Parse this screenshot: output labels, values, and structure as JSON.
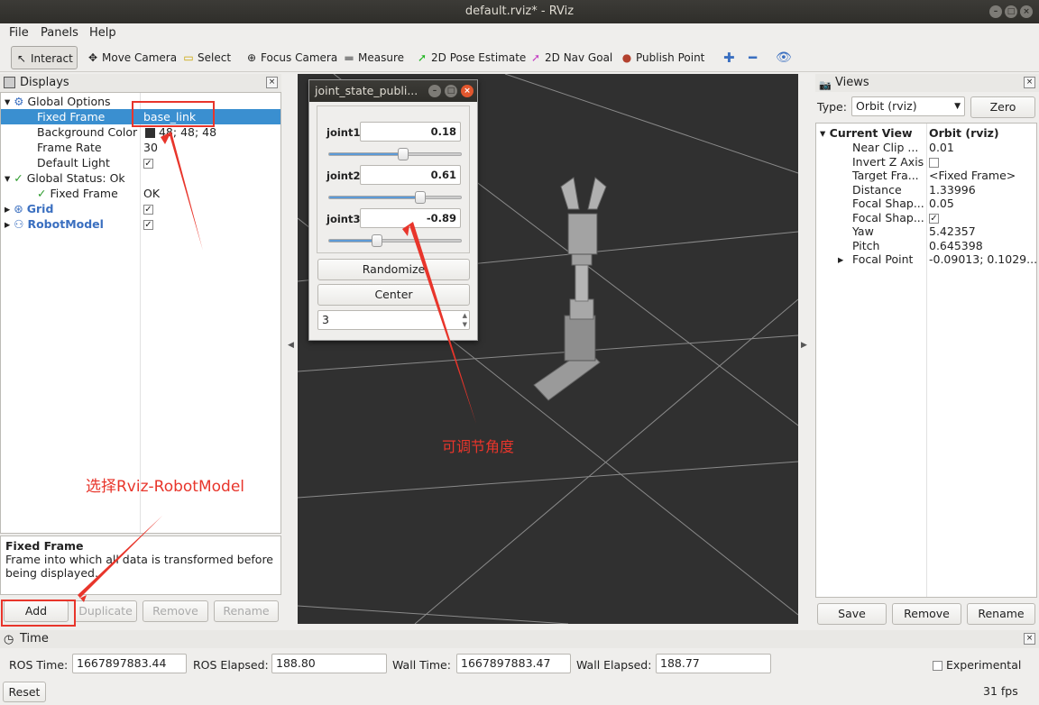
{
  "window": {
    "title": "default.rviz* - RViz"
  },
  "menu": [
    "File",
    "Panels",
    "Help"
  ],
  "toolbar": [
    {
      "label": "Interact",
      "icon": "↖",
      "name": "interact-button"
    },
    {
      "label": "Move Camera",
      "icon": "✥",
      "name": "move-camera-button"
    },
    {
      "label": "Select",
      "icon": "▭",
      "name": "select-button"
    },
    {
      "label": "Focus Camera",
      "icon": "⊕",
      "name": "focus-camera-button"
    },
    {
      "label": "Measure",
      "icon": "▬",
      "name": "measure-button"
    },
    {
      "label": "2D Pose Estimate",
      "icon": "➚",
      "name": "2d-pose-estimate-button"
    },
    {
      "label": "2D Nav Goal",
      "icon": "➚",
      "name": "2d-nav-goal-button"
    },
    {
      "label": "Publish Point",
      "icon": "●",
      "name": "publish-point-button"
    }
  ],
  "displays": {
    "title": "Displays",
    "rows": {
      "global_options": "Global Options",
      "fixed_frame_label": "Fixed Frame",
      "fixed_frame_value": "base_link",
      "bg_color_label": "Background Color",
      "bg_color_value": "48; 48; 48",
      "frame_rate_label": "Frame Rate",
      "frame_rate_value": "30",
      "default_light_label": "Default Light",
      "global_status": "Global Status: Ok",
      "gs_fixed_frame_label": "Fixed Frame",
      "gs_fixed_frame_value": "OK",
      "grid": "Grid",
      "robot_model": "RobotModel"
    },
    "desc_title": "Fixed Frame",
    "desc_text": "Frame into which all data is transformed before being displayed.",
    "buttons": {
      "add": "Add",
      "duplicate": "Duplicate",
      "remove": "Remove",
      "rename": "Rename"
    }
  },
  "joint_popup": {
    "title": "joint_state_publi...",
    "joints": [
      {
        "label": "joint1",
        "value": "0.18",
        "fraction": 0.56
      },
      {
        "label": "joint2",
        "value": "0.61",
        "fraction": 0.69
      },
      {
        "label": "joint3",
        "value": "-0.89",
        "fraction": 0.36
      }
    ],
    "randomize": "Randomize",
    "center": "Center",
    "spin_value": "3"
  },
  "views": {
    "title": "Views",
    "type_label": "Type:",
    "type_value": "Orbit (rviz)",
    "zero": "Zero",
    "current_view": "Current View",
    "current_view_value": "Orbit (rviz)",
    "props": [
      {
        "k": "Near Clip ...",
        "v": "0.01"
      },
      {
        "k": "Invert Z Axis",
        "v": ""
      },
      {
        "k": "Target Fra...",
        "v": "<Fixed Frame>"
      },
      {
        "k": "Distance",
        "v": "1.33996"
      },
      {
        "k": "Focal Shap...",
        "v": "0.05"
      },
      {
        "k": "Focal Shap...",
        "v": ""
      },
      {
        "k": "Yaw",
        "v": "5.42357"
      },
      {
        "k": "Pitch",
        "v": "0.645398"
      },
      {
        "k": "Focal Point",
        "v": "-0.09013; 0.1029..."
      }
    ],
    "buttons": {
      "save": "Save",
      "remove": "Remove",
      "rename": "Rename"
    }
  },
  "time": {
    "title": "Time",
    "ros_time_label": "ROS Time:",
    "ros_time": "1667897883.44",
    "ros_elapsed_label": "ROS Elapsed:",
    "ros_elapsed": "188.80",
    "wall_time_label": "Wall Time:",
    "wall_time": "1667897883.47",
    "wall_elapsed_label": "Wall Elapsed:",
    "wall_elapsed": "188.77",
    "experimental": "Experimental",
    "reset": "Reset",
    "fps": "31 fps"
  },
  "annotations": {
    "adjust": "可调节角度",
    "select": "选择Rviz-RobotModel"
  },
  "colors": {
    "accent": "#3a8fd0",
    "viewport_bg": "#303030",
    "annotation": "#e8352b"
  }
}
